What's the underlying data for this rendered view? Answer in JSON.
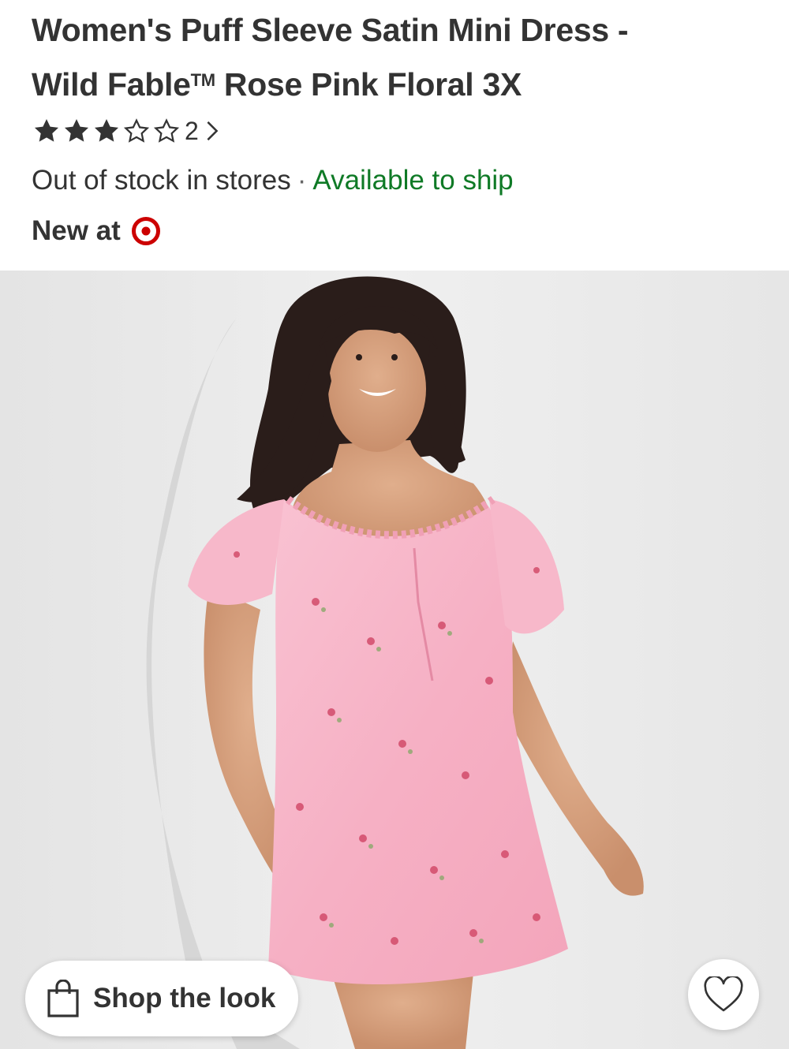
{
  "product": {
    "title_line1": "Women's Puff Sleeve Satin Mini Dress -",
    "title_line2_pre": "Wild Fable",
    "title_trademark": "TM",
    "title_line2_post": " Rose Pink Floral 3X",
    "rating": {
      "value": 3,
      "max": 5,
      "count": "2",
      "filled_color": "#333333"
    },
    "availability": {
      "store_status": "Out of stock in stores",
      "separator": "·",
      "ship_status": "Available to ship",
      "ship_color": "#0f7a26"
    },
    "new_at_label": "New at",
    "brand_logo_icon": "target-bullseye-icon",
    "brand_color": "#cc0000"
  },
  "image": {
    "description_icon": "product-photo",
    "dress_color": "#f6b6c8"
  },
  "actions": {
    "shop_the_look_label": "Shop the look",
    "shop_icon": "shopping-bag-icon",
    "favorite_icon": "heart-outline-icon"
  }
}
